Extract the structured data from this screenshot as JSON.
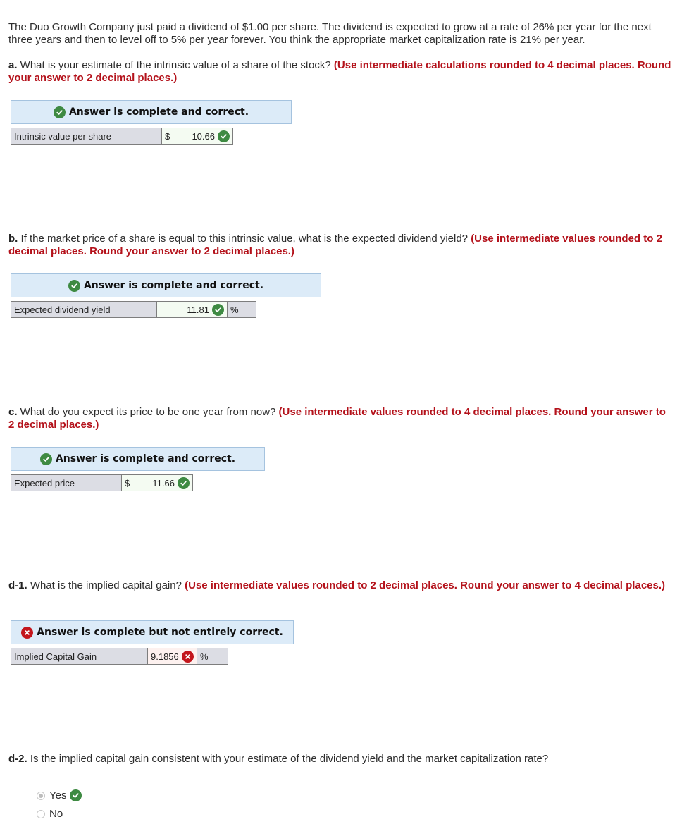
{
  "intro": "The Duo Growth Company just paid a dividend of $1.00 per share. The dividend is expected to grow at a rate of 26% per year for the next three years and then to level off to 5% per year forever. You think the appropriate market capitalization rate is 21% per year.",
  "questions": {
    "a": {
      "prefix": "a.",
      "text": " What is your estimate of the intrinsic value of a share of the stock? ",
      "instruction": "(Use intermediate calculations rounded to 4 decimal places. Round your answer to 2 decimal places.)",
      "banner": "Answer is complete and correct.",
      "banner_status": "correct",
      "row_label": "Intrinsic value per share",
      "currency": "$",
      "value": "10.66",
      "value_status": "correct"
    },
    "b": {
      "prefix": "b.",
      "text": " If the market price of a share is equal to this intrinsic value, what is the expected dividend yield? ",
      "instruction": "(Use intermediate values rounded to 2 decimal places. Round your answer to 2 decimal places.)",
      "banner": "Answer is complete and correct.",
      "banner_status": "correct",
      "row_label": "Expected dividend yield",
      "value": "11.81",
      "unit": "%",
      "value_status": "correct"
    },
    "c": {
      "prefix": "c.",
      "text": " What do you expect its price to be one year from now? ",
      "instruction": "(Use intermediate values rounded to 4 decimal places. Round your answer to 2 decimal places.)",
      "banner": "Answer is complete and correct.",
      "banner_status": "correct",
      "row_label": "Expected price",
      "currency": "$",
      "value": "11.66",
      "value_status": "correct"
    },
    "d1": {
      "prefix": "d-1.",
      "text": " What is the implied capital gain? ",
      "instruction": "(Use intermediate values rounded to 2 decimal places. Round your answer to 4 decimal places.)",
      "banner": "Answer is complete but not entirely correct.",
      "banner_status": "incorrect",
      "row_label": "Implied Capital Gain",
      "value": "9.1856",
      "unit": "%",
      "value_status": "incorrect"
    },
    "d2": {
      "prefix": "d-2.",
      "text": " Is the implied capital gain consistent with your estimate of the dividend yield and the market capitalization rate?",
      "options": [
        {
          "label": "Yes",
          "selected": true,
          "status": "correct"
        },
        {
          "label": "No",
          "selected": false
        }
      ]
    }
  },
  "icons": {
    "correct": "check-circle-icon",
    "incorrect": "x-circle-icon"
  },
  "colors": {
    "instruction_red": "#b4121b",
    "correct_green": "#3e8a42",
    "incorrect_red": "#c3161c",
    "banner_bg": "#dcebf8"
  }
}
